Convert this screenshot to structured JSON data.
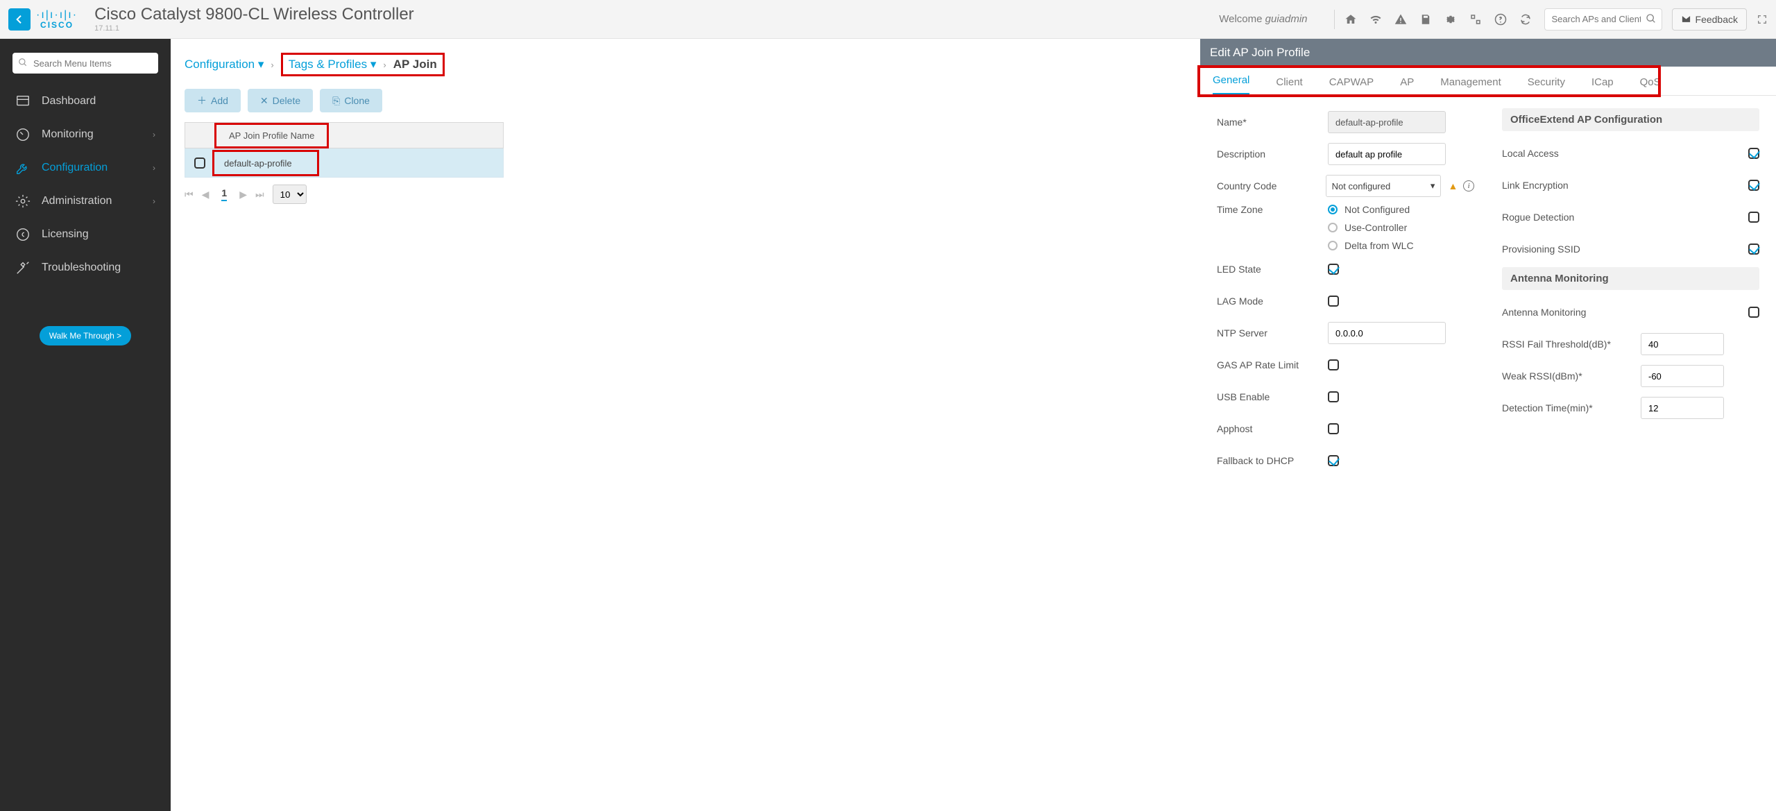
{
  "topbar": {
    "product_title": "Cisco Catalyst 9800-CL Wireless Controller",
    "version": "17.11.1",
    "welcome_prefix": "Welcome ",
    "welcome_user": "guiadmin",
    "search_placeholder": "Search APs and Clients",
    "feedback_label": "Feedback"
  },
  "sidebar": {
    "search_placeholder": "Search Menu Items",
    "items": [
      {
        "label": "Dashboard"
      },
      {
        "label": "Monitoring",
        "expandable": true
      },
      {
        "label": "Configuration",
        "expandable": true
      },
      {
        "label": "Administration",
        "expandable": true
      },
      {
        "label": "Licensing"
      },
      {
        "label": "Troubleshooting"
      }
    ],
    "walk_label": "Walk Me Through >"
  },
  "breadcrumb": {
    "root": "Configuration",
    "mid": "Tags & Profiles",
    "current": "AP Join"
  },
  "actions": {
    "add": "Add",
    "delete": "Delete",
    "clone": "Clone"
  },
  "grid": {
    "header": "AP Join Profile Name",
    "rows": [
      {
        "name": "default-ap-profile"
      }
    ],
    "page": "1",
    "page_size": "10"
  },
  "panel": {
    "title": "Edit AP Join Profile",
    "tabs": [
      "General",
      "Client",
      "CAPWAP",
      "AP",
      "Management",
      "Security",
      "ICap",
      "QoS"
    ],
    "general_left_labels": {
      "name": "Name*",
      "description": "Description",
      "country": "Country Code",
      "timezone": "Time Zone",
      "led": "LED State",
      "lag": "LAG Mode",
      "ntp": "NTP Server",
      "gas": "GAS AP Rate Limit",
      "usb": "USB Enable",
      "apphost": "Apphost",
      "fallback": "Fallback to DHCP"
    },
    "general_left_values": {
      "name": "default-ap-profile",
      "description": "default ap profile",
      "country": "Not configured",
      "timezone_options": [
        "Not Configured",
        "Use-Controller",
        "Delta from WLC"
      ],
      "timezone_selected": 0,
      "led": true,
      "lag": false,
      "ntp": "0.0.0.0",
      "gas": false,
      "usb": false,
      "apphost": false,
      "fallback": true
    },
    "general_right": {
      "section1": "OfficeExtend AP Configuration",
      "local_access_label": "Local Access",
      "local_access": true,
      "link_encryption_label": "Link Encryption",
      "link_encryption": true,
      "rogue_label": "Rogue Detection",
      "rogue": false,
      "prov_label": "Provisioning SSID",
      "prov": true,
      "section2": "Antenna Monitoring",
      "ant_mon_label": "Antenna Monitoring",
      "ant_mon": false,
      "rssi_fail_label": "RSSI Fail Threshold(dB)*",
      "rssi_fail": "40",
      "weak_rssi_label": "Weak RSSI(dBm)*",
      "weak_rssi": "-60",
      "det_time_label": "Detection Time(min)*",
      "det_time": "12"
    }
  }
}
